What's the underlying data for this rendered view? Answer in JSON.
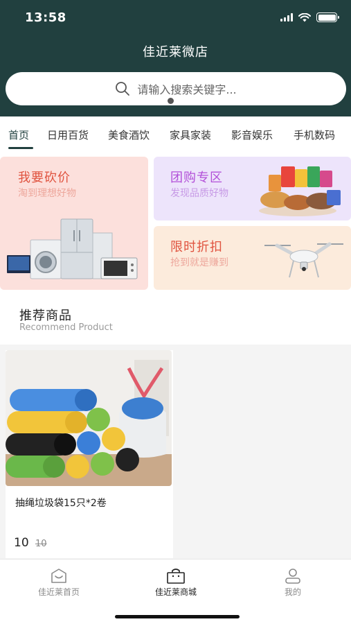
{
  "status_bar": {
    "time": "13:58"
  },
  "app": {
    "title": "佳近莱微店"
  },
  "search": {
    "placeholder": "请输入搜索关键字..."
  },
  "tabs": [
    {
      "label": "首页",
      "active": true
    },
    {
      "label": "日用百货"
    },
    {
      "label": "美食酒饮"
    },
    {
      "label": "家具家装"
    },
    {
      "label": "影音娱乐"
    },
    {
      "label": "手机数码"
    }
  ],
  "promos": [
    {
      "title": "我要砍价",
      "subtitle": "淘到理想好物",
      "title_color": "#e0533f",
      "bg": "#fce0dc",
      "image": "appliances"
    },
    {
      "title": "团购专区",
      "subtitle": "发现品质好物",
      "title_color": "#b24fd8",
      "bg": "#ede4fb",
      "image": "snacks"
    },
    {
      "title": "限时折扣",
      "subtitle": "抢到就是赚到",
      "title_color": "#e0533f",
      "bg": "#fcebdc",
      "image": "drone"
    }
  ],
  "recommend": {
    "title": "推荐商品",
    "subtitle": "Recommend Product"
  },
  "products": [
    {
      "name": "抽绳垃圾袋15只*2卷",
      "price": "10",
      "old_price": "10"
    }
  ],
  "bottom_nav": [
    {
      "label": "佳近莱首页",
      "icon": "home-icon"
    },
    {
      "label": "佳近莱商城",
      "icon": "shopping-bag-icon",
      "active": true
    },
    {
      "label": "我的",
      "icon": "user-icon"
    }
  ]
}
